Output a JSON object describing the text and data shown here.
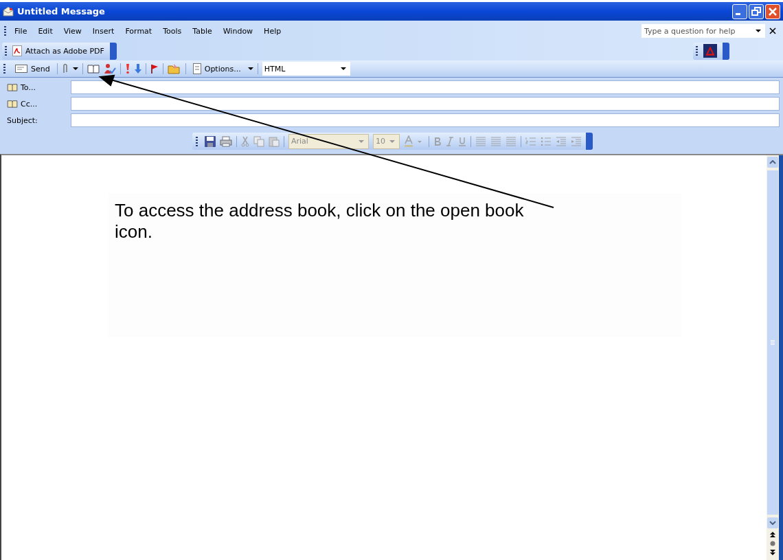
{
  "window": {
    "title": "Untitled Message"
  },
  "menu": [
    "File",
    "Edit",
    "View",
    "Insert",
    "Format",
    "Tools",
    "Table",
    "Window",
    "Help"
  ],
  "help": {
    "placeholder": "Type a question for help"
  },
  "pdf_toolbar": {
    "label": "Attach as Adobe PDF"
  },
  "standard_toolbar": {
    "send": "Send",
    "options": "Options...",
    "format": "HTML"
  },
  "header": [
    {
      "label": "To...",
      "book": true
    },
    {
      "label": "Cc...",
      "book": true
    },
    {
      "label": "Subject:",
      "book": false
    }
  ],
  "formatting_toolbar": {
    "disabled": true,
    "font": "Arial",
    "size": "10"
  },
  "annotation": {
    "text": "To access the address book, click on the open book icon."
  }
}
